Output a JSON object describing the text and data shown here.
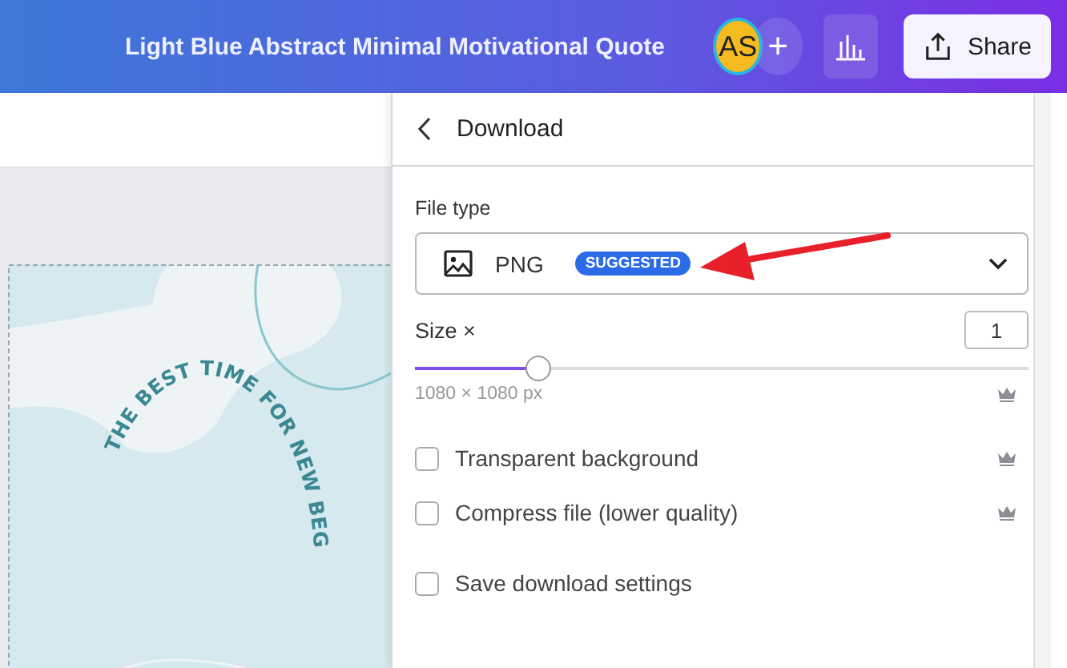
{
  "header": {
    "title": "Light Blue Abstract Minimal Motivational Quote",
    "avatar": {
      "initials": "AS"
    },
    "add_button": {
      "label": "+"
    },
    "share_button": {
      "label": "Share"
    }
  },
  "design": {
    "quote": "THE BEST TIME FOR NEW BEG"
  },
  "download_panel": {
    "title": "Download",
    "file_type": {
      "label": "File type",
      "value": "PNG",
      "badge": "SUGGESTED"
    },
    "size": {
      "label": "Size ×",
      "value": "1",
      "level": 0.2,
      "dimensions": "1080 × 1080 px",
      "premium": true
    },
    "options": [
      {
        "label": "Transparent background",
        "checked": false,
        "premium": true
      },
      {
        "label": "Compress file (lower quality)",
        "checked": false,
        "premium": true
      },
      {
        "label": "Save download settings",
        "checked": false,
        "premium": false
      }
    ]
  }
}
